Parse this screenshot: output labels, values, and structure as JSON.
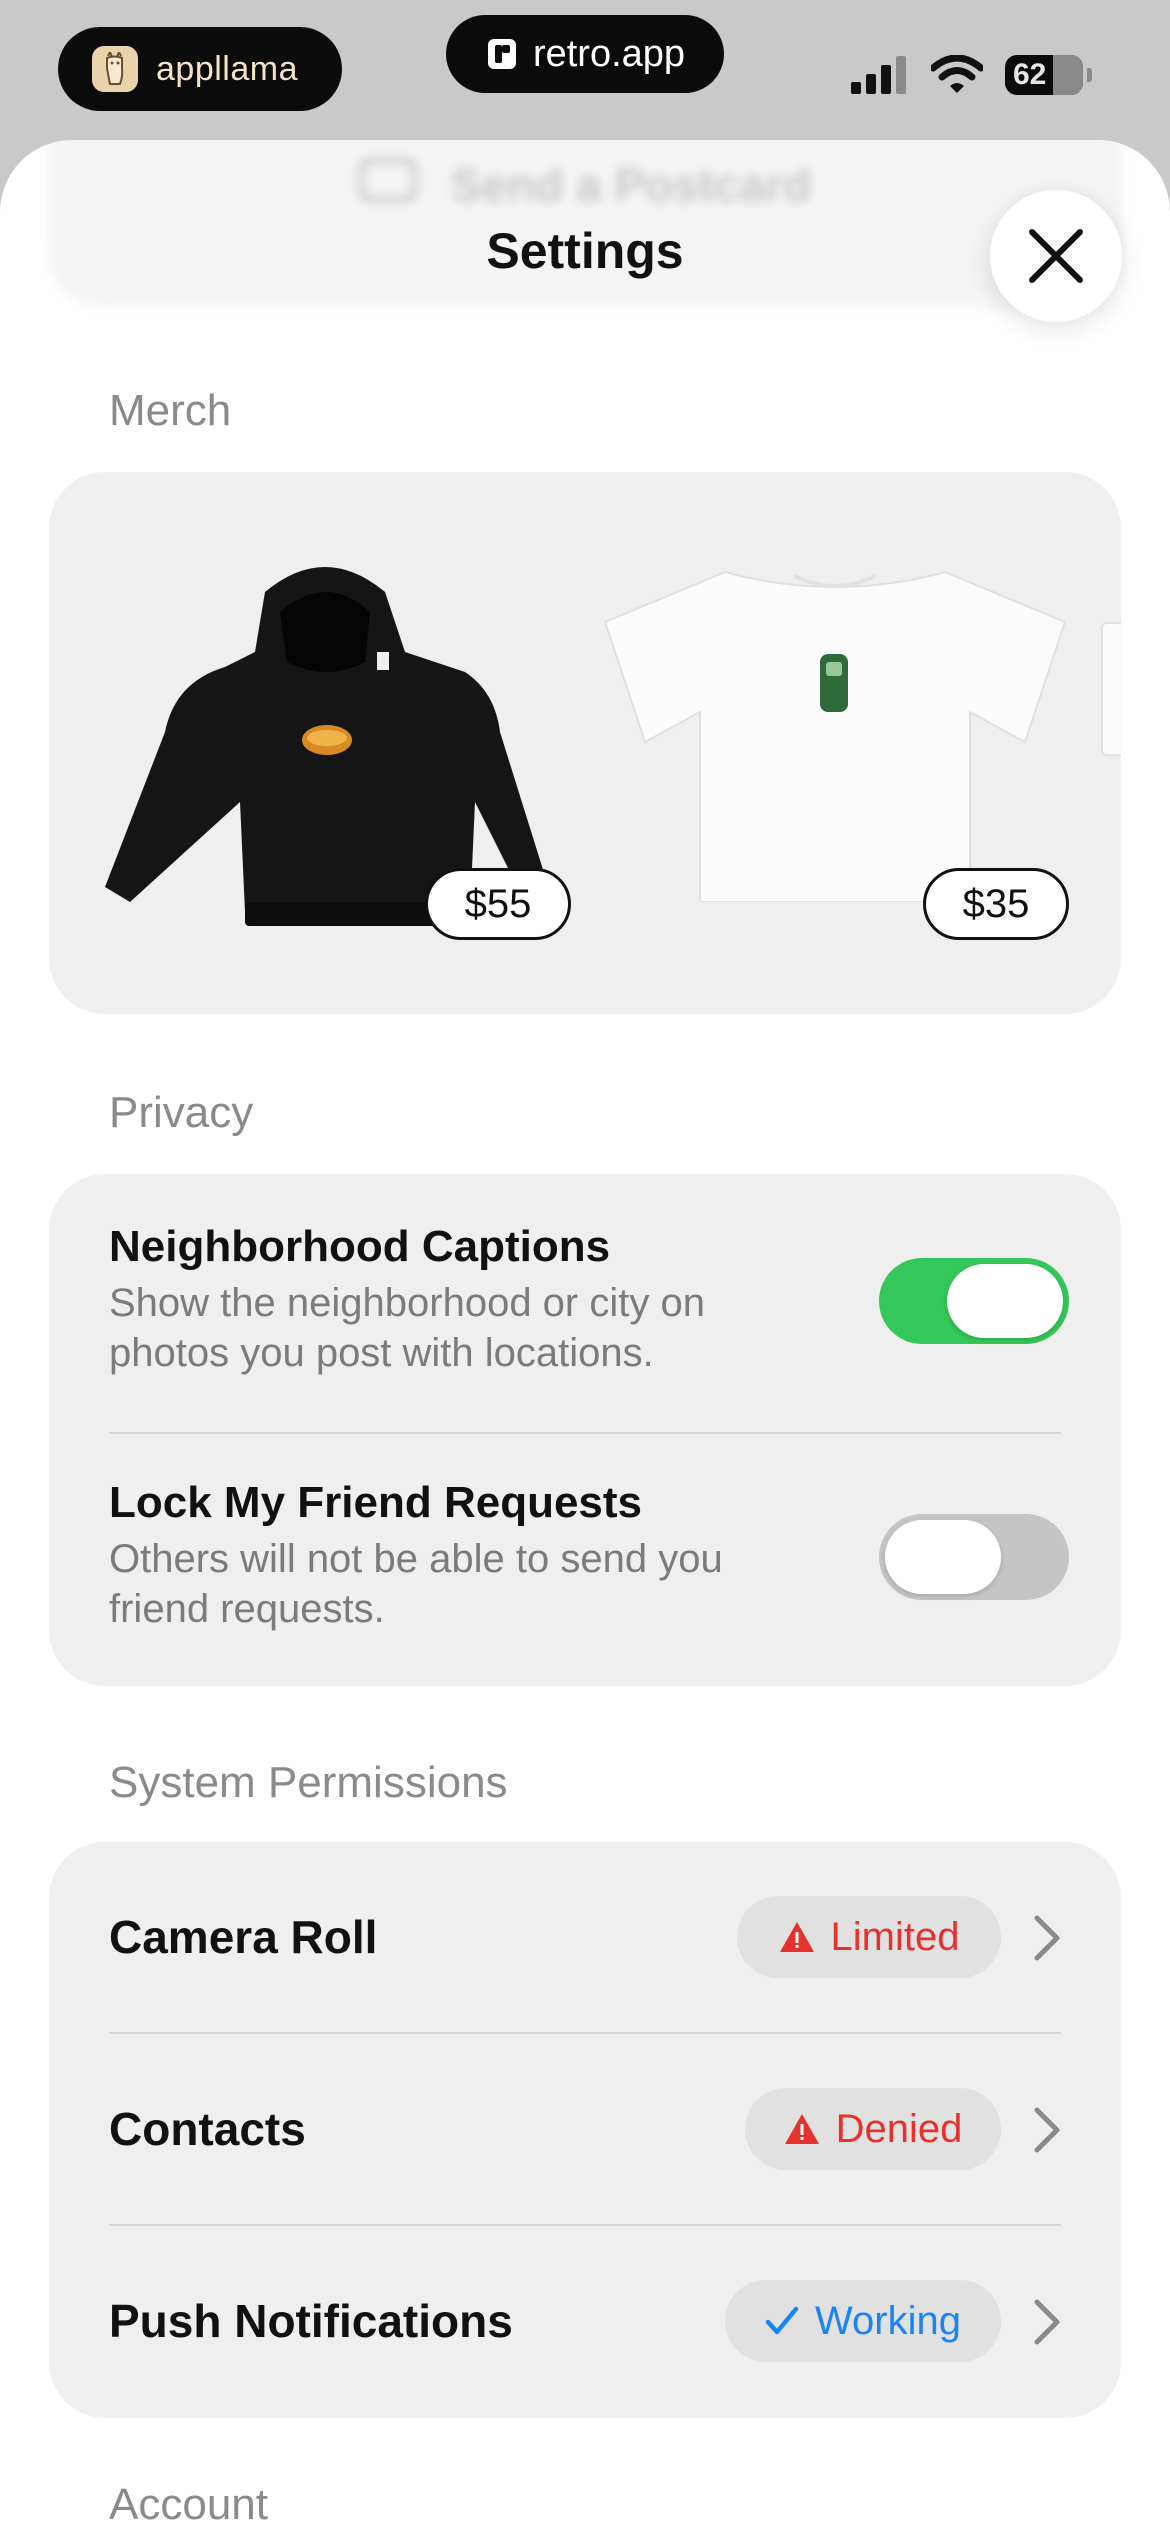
{
  "status_bar": {
    "badge_text": "appllama",
    "url_text": "retro.app",
    "battery_level": "62",
    "icons": [
      "llama-logo-icon",
      "retro-logo-icon",
      "signal-icon",
      "wifi-icon",
      "battery-icon"
    ]
  },
  "sheet": {
    "ghost_button_label": "Send a Postcard",
    "title": "Settings",
    "close_icon": "close-icon"
  },
  "merch": {
    "label": "Merch",
    "items": [
      {
        "name": "hoodie",
        "price": "$55"
      },
      {
        "name": "t-shirt",
        "price": "$35"
      }
    ]
  },
  "privacy": {
    "label": "Privacy",
    "rows": [
      {
        "title": "Neighborhood Captions",
        "description": "Show the neighborhood or city on photos you post with locations.",
        "enabled": true
      },
      {
        "title": "Lock My Friend Requests",
        "description": "Others will not be able to send you friend requests.",
        "enabled": false
      }
    ]
  },
  "permissions": {
    "label": "System Permissions",
    "rows": [
      {
        "label": "Camera Roll",
        "status": "Limited",
        "status_icon": "warning-icon"
      },
      {
        "label": "Contacts",
        "status": "Denied",
        "status_icon": "warning-icon"
      },
      {
        "label": "Push Notifications",
        "status": "Working",
        "status_icon": "checkmark-icon"
      }
    ]
  },
  "account": {
    "label": "Account"
  },
  "colors": {
    "toggle_on": "#34c759",
    "toggle_off": "#c5c5c5",
    "warning": "#e5322d",
    "working": "#1a84f2"
  }
}
